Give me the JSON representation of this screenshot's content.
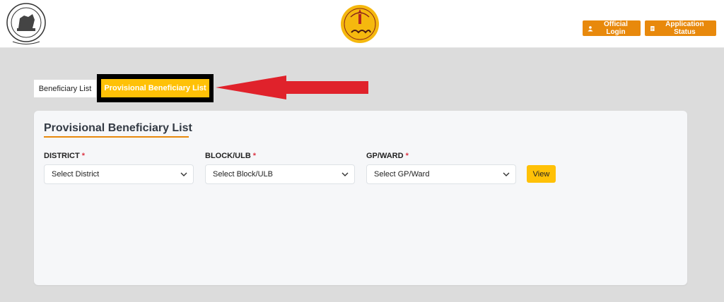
{
  "header": {
    "official_login": "Official Login",
    "application_status": "Application Status"
  },
  "tabs": {
    "beneficiary_list": "Beneficiary List",
    "provisional_beneficiary_list": "Provisional Beneficiary List"
  },
  "card": {
    "title": "Provisional Beneficiary List"
  },
  "filters": {
    "district": {
      "label": "DISTRICT",
      "required": "*",
      "value": "Select District"
    },
    "block": {
      "label": "BLOCK/ULB",
      "required": "*",
      "value": "Select Block/ULB"
    },
    "gp": {
      "label": "GP/WARD",
      "required": "*",
      "value": "Select GP/Ward"
    },
    "view_label": "View"
  },
  "colors": {
    "accent_orange": "#e8890c",
    "accent_yellow": "#ffc107",
    "annotation_arrow": "#e0222b",
    "required_mark": "#dc3545"
  }
}
